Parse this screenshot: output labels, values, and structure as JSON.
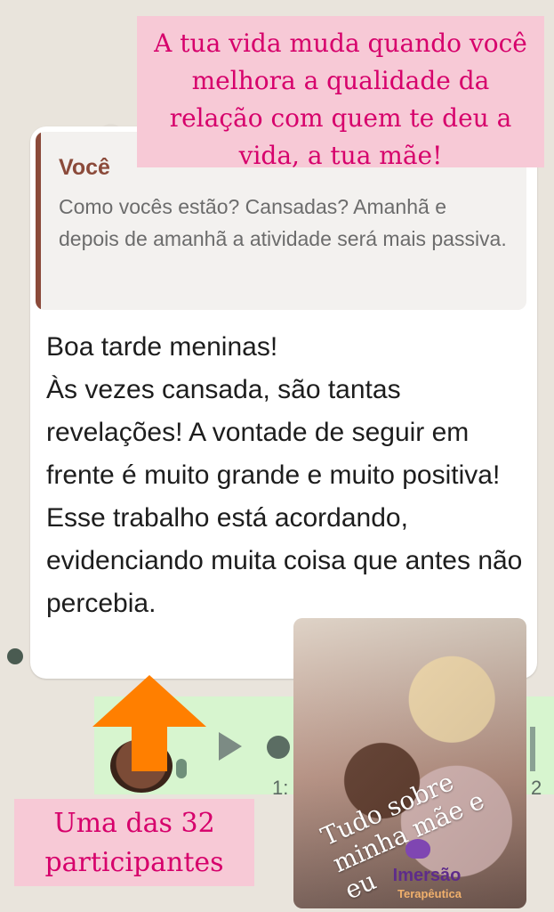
{
  "captions": {
    "top": "A tua vida muda quando você melhora a qualidade da relação com quem te deu a vida, a tua mãe!",
    "bottom": "Uma das 32 participantes"
  },
  "quote": {
    "author": "Você",
    "text": "Como vocês estão? Cansadas? Amanhã e depois de amanhã a atividade será mais passiva."
  },
  "message": {
    "text": "Boa tarde meninas!\nÀs vezes cansada, são tantas revelações! A vontade de seguir em frente é muito grande e muito positiva! Esse trabalho está acordando, evidenciando muita coisa que antes não percebia."
  },
  "audio": {
    "time_left": "1:",
    "time_right": "2"
  },
  "photo": {
    "caption": "Tudo sobre minha mãe e eu",
    "brand": "Imersão",
    "brand_sub": "Terapêutica"
  },
  "colors": {
    "pink_label": "#f7c9d6",
    "magenta_text": "#d6006b",
    "orange_arrow": "#ff7f00",
    "quote_bar": "#8b4a3a",
    "audio_bg": "#d7f5cf"
  }
}
